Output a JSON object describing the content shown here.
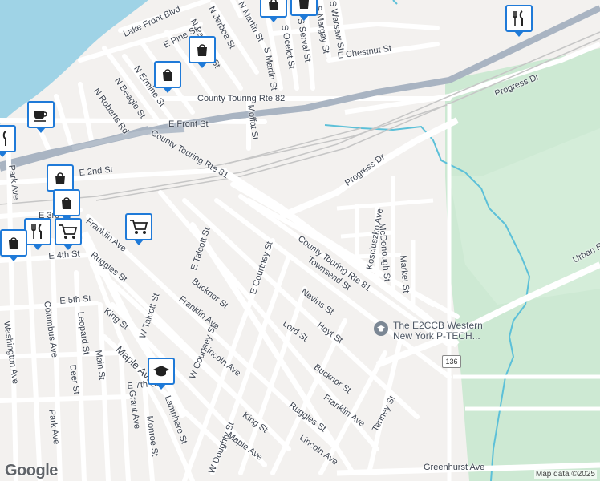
{
  "colors": {
    "water": "#9fd3e6",
    "park": "#cde9d3",
    "road": "#ffffff",
    "highway": "#a9b4c2",
    "rail": "#c9c9c9",
    "pin_border": "#1f7ad8",
    "stream": "#5cc0d8"
  },
  "streets": {
    "lake_front": "Lake Front Blvd",
    "e_pine": "E Pine St",
    "n_jerboa": "N Jerboa St",
    "n_pangolin": "N Pangolin St",
    "martin": "N Martin St",
    "s_ocelot": "S Ocelot St",
    "s_serval": "S Serval St",
    "s_margay": "S Margay St",
    "s_warsaw": "S Warsaw St",
    "e_chestnut": "E Chestnut St",
    "s_martin": "S Martin St",
    "n_ermine": "N Ermine St",
    "n_beagle": "N Beagle St",
    "n_roberts": "N Roberts Rd",
    "ct82": "County Touring Rte 82",
    "progress_dr_top": "Progress Dr",
    "moffat": "Moffat St",
    "e_front": "E Front St",
    "ct81_west": "County Touring Rte 81",
    "e_2nd": "E 2nd St",
    "park_ave_n": "Park Ave",
    "progress_dr_mid": "Progress Dr",
    "e_3rd": "E 3rd St",
    "franklin_w": "Franklin Ave",
    "e_talcott": "E Talcott St",
    "e_4th": "E 4th St",
    "ruggles_w": "Ruggles St",
    "kosciuszko": "Kosciuszko Ave",
    "mcdonough": "McDonough St",
    "market": "Market St",
    "ct81_east": "County Touring Rte 81",
    "e_courtney": "E Courtney St",
    "townsend": "Townsend St",
    "urban_rd": "Urban Rd",
    "e_5th": "E 5th St",
    "columbus": "Columbus Ave",
    "leopard": "Leopard St",
    "bucknor_w": "Bucknor St",
    "nevins": "Nevins St",
    "king_w": "King St",
    "w_talcott": "W Talcott St",
    "franklin_mid": "Franklin Ave",
    "hoyt": "Hoyt St",
    "washington": "Washington Ave",
    "deer": "Deer St",
    "main": "Main St",
    "maple_w": "Maple Ave",
    "lord": "Lord St",
    "w_courtney": "W Courtney St",
    "lincoln_mid": "Lincoln Ave",
    "bucknor_e": "Bucknor St",
    "e_7th": "E 7th St",
    "grant": "Grant Ave",
    "franklin_e": "Franklin Ave",
    "tenney": "Tenney St",
    "park_ave_s": "Park Ave",
    "monroe": "Monroe St",
    "lamphere": "Lamphere St",
    "w_doughty": "W Doughty St",
    "king_e": "King St",
    "ruggles_e": "Ruggles St",
    "maple_e": "Maple Ave",
    "lincoln_e": "Lincoln Ave",
    "greenhurst": "Greenhurst Ave"
  },
  "poi": {
    "school_name": "The E2CCB Western New York P-TECH..."
  },
  "shields": {
    "route_136": "136"
  },
  "pins": [
    {
      "icon": "shopping-bag-icon"
    },
    {
      "icon": "shopping-bag-icon"
    },
    {
      "icon": "shopping-bag-icon"
    },
    {
      "icon": "restaurant-icon"
    },
    {
      "icon": "coffee-cup-icon"
    },
    {
      "icon": "restaurant-icon"
    },
    {
      "icon": "shopping-bag-icon"
    },
    {
      "icon": "shopping-bag-icon"
    },
    {
      "icon": "shopping-cart-icon"
    },
    {
      "icon": "shopping-cart-icon"
    },
    {
      "icon": "shopping-bag-icon"
    },
    {
      "icon": "restaurant-icon"
    },
    {
      "icon": "graduation-cap-icon"
    }
  ],
  "branding": {
    "logo": "Google",
    "attribution": "Map data ©2025"
  }
}
